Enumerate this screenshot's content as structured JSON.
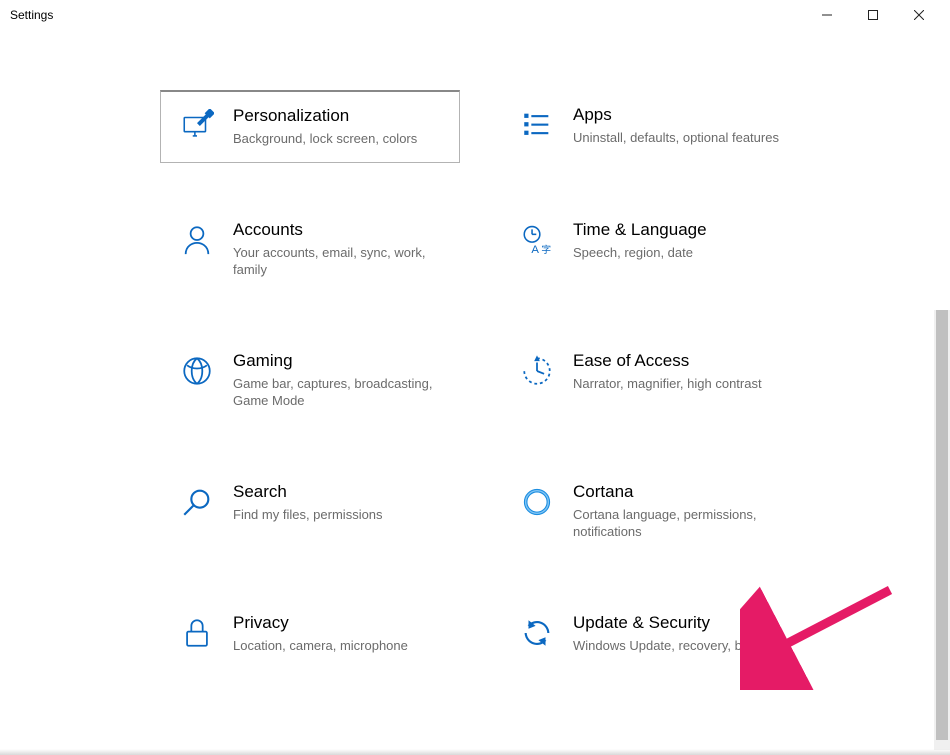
{
  "window": {
    "title": "Settings"
  },
  "colors": {
    "accent": "#0b68c1",
    "muted": "#6b6b6b",
    "arrow": "#e51b66"
  },
  "cards": {
    "personalization": {
      "title": "Personalization",
      "desc": "Background, lock screen, colors"
    },
    "apps": {
      "title": "Apps",
      "desc": "Uninstall, defaults, optional features"
    },
    "accounts": {
      "title": "Accounts",
      "desc": "Your accounts, email, sync, work, family"
    },
    "time": {
      "title": "Time & Language",
      "desc": "Speech, region, date"
    },
    "gaming": {
      "title": "Gaming",
      "desc": "Game bar, captures, broadcasting, Game Mode"
    },
    "ease": {
      "title": "Ease of Access",
      "desc": "Narrator, magnifier, high contrast"
    },
    "search": {
      "title": "Search",
      "desc": "Find my files, permissions"
    },
    "cortana": {
      "title": "Cortana",
      "desc": "Cortana language, permissions, notifications"
    },
    "privacy": {
      "title": "Privacy",
      "desc": "Location, camera, microphone"
    },
    "update": {
      "title": "Update & Security",
      "desc": "Windows Update, recovery, backup"
    }
  }
}
